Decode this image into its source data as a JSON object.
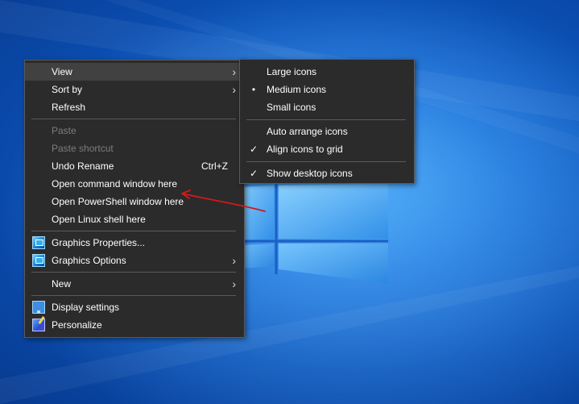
{
  "colors": {
    "menu_bg": "#2b2b2b",
    "menu_border": "#5a5a5a",
    "hover_bg": "#414141",
    "disabled_text": "#7c7c7c",
    "annotation_arrow": "#d11a1a"
  },
  "context_menu": {
    "items": [
      {
        "label": "View",
        "submenu": true,
        "highlighted": true
      },
      {
        "label": "Sort by",
        "submenu": true
      },
      {
        "label": "Refresh"
      },
      {
        "label": "Paste",
        "disabled": true
      },
      {
        "label": "Paste shortcut",
        "disabled": true
      },
      {
        "label": "Undo Rename",
        "shortcut": "Ctrl+Z"
      },
      {
        "label": "Open command window here"
      },
      {
        "label": "Open PowerShell window here"
      },
      {
        "label": "Open Linux shell here"
      },
      {
        "label": "Graphics Properties...",
        "icon": "intel-graphics-icon"
      },
      {
        "label": "Graphics Options",
        "icon": "intel-graphics-icon",
        "submenu": true
      },
      {
        "label": "New",
        "submenu": true
      },
      {
        "label": "Display settings",
        "icon": "display-settings-icon"
      },
      {
        "label": "Personalize",
        "icon": "personalize-icon"
      }
    ]
  },
  "view_submenu": {
    "items": [
      {
        "label": "Large icons"
      },
      {
        "label": "Medium icons",
        "marker": "•",
        "selected": true
      },
      {
        "label": "Small icons"
      },
      {
        "label": "Auto arrange icons"
      },
      {
        "label": "Align icons to grid",
        "marker": "✓",
        "checked": true
      },
      {
        "label": "Show desktop icons",
        "marker": "✓",
        "checked": true
      }
    ]
  },
  "glyphs": {
    "submenu_arrow": "›"
  }
}
